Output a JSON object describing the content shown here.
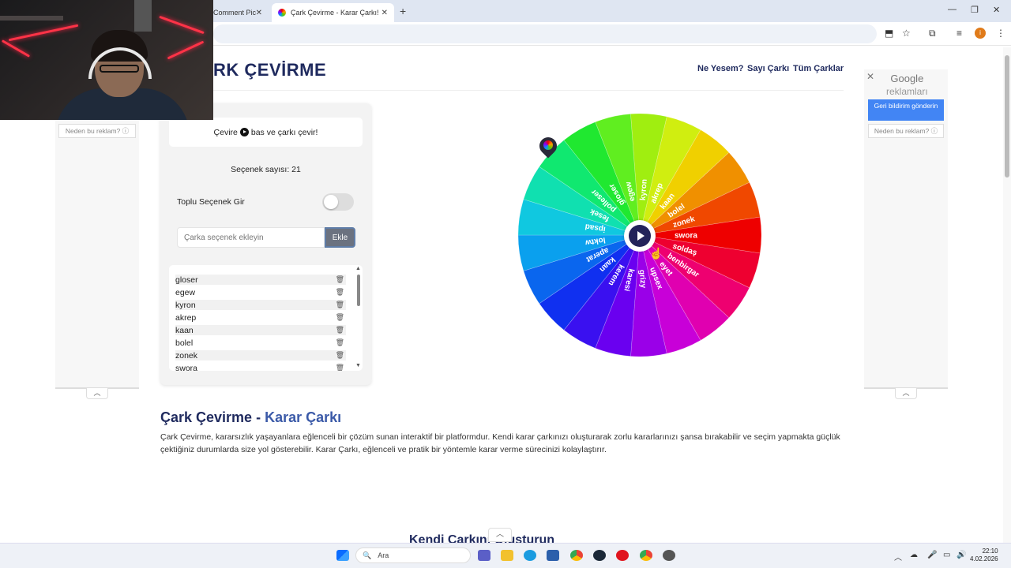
{
  "browser": {
    "tabs": [
      {
        "label": "Comment Pic"
      },
      {
        "label": "Çark Çevirme - Karar Çarkı!"
      }
    ],
    "new_tab": "+",
    "win_minimize": "—",
    "win_restore": "❐",
    "win_close": "✕",
    "profile_initial": "i"
  },
  "header": {
    "brand": "RK ÇEVİRME",
    "nav": [
      "Ne Yesem?",
      "Sayı Çarkı",
      "Tüm Çarklar"
    ]
  },
  "ads": {
    "left_why": "Neden bu reklam? ⓘ",
    "right_why": "Neden bu reklam? ⓘ",
    "google_title": "Google",
    "google_sub": "reklamları",
    "feedback": "Geri bildirim gönderin",
    "close": "✕",
    "caret": "︿"
  },
  "panel": {
    "instruction_prefix": "Çevire",
    "instruction_suffix": "bas ve çarkı çevir!",
    "count_label": "Seçenek sayısı: 21",
    "bulk_label": "Toplu Seçenek Gir",
    "input_placeholder": "Çarka seçenek ekleyin",
    "add_label": "Ekle",
    "items": [
      "gloser",
      "egew",
      "kyron",
      "akrep",
      "kaan",
      "bolel",
      "zonek",
      "swora"
    ]
  },
  "wheel": {
    "segments": [
      {
        "label": "swora",
        "color": "#ee0000"
      },
      {
        "label": "soldaş",
        "color": "#ee0030"
      },
      {
        "label": "benbirgar",
        "color": "#ee0070"
      },
      {
        "label": "eyet",
        "color": "#e000b0"
      },
      {
        "label": "upsex",
        "color": "#c800d8"
      },
      {
        "label": "grizy",
        "color": "#9a00e8"
      },
      {
        "label": "karesi",
        "color": "#6a00f0"
      },
      {
        "label": "kerem",
        "color": "#3a10f0"
      },
      {
        "label": "kaan",
        "color": "#1030f0"
      },
      {
        "label": "aperat",
        "color": "#0a66ee"
      },
      {
        "label": "loktw",
        "color": "#0aa0ee"
      },
      {
        "label": "ipsad",
        "color": "#10c8e0"
      },
      {
        "label": "fesek",
        "color": "#10e0b0"
      },
      {
        "label": "polleser",
        "color": "#10e870"
      },
      {
        "label": "gloser",
        "color": "#20e830"
      },
      {
        "label": "egew",
        "color": "#60ee20"
      },
      {
        "label": "kyron",
        "color": "#a0ee10"
      },
      {
        "label": "akrep",
        "color": "#d0ee10"
      },
      {
        "label": "kaan",
        "color": "#f0d000"
      },
      {
        "label": "bolel",
        "color": "#f09000"
      },
      {
        "label": "zonek",
        "color": "#f04800"
      }
    ]
  },
  "article": {
    "title_dark": "Çark Çevirme - ",
    "title_accent": "Karar Çarkı",
    "body": "Çark Çevirme, kararsızlık yaşayanlara eğlenceli bir çözüm sunan interaktif bir platformdur. Kendi karar çarkınızı oluşturarak zorlu kararlarınızı şansa bırakabilir ve seçim yapmakta güçlük çektiğiniz durumlarda size yol gösterebilir. Karar Çarkı, eğlenceli ve pratik bir yöntemle karar verme sürecinizi kolaylaştırır.",
    "next_heading": "Kendi Çarkını Oluşturun"
  },
  "taskbar": {
    "search_label": "Ara",
    "time": "22:10",
    "date": "4.02.2026"
  }
}
